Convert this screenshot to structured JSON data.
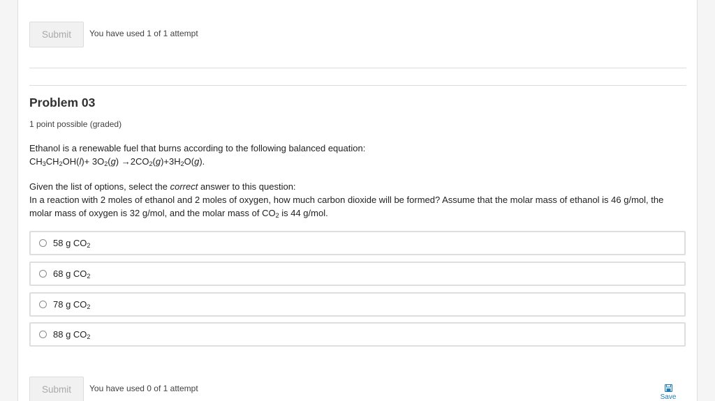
{
  "top_submit": {
    "button_label": "Submit",
    "attempt_text": "You have used 1 of 1 attempt"
  },
  "problem": {
    "title": "Problem 03",
    "points": "1 point possible (graded)",
    "intro": "Ethanol is a renewable fuel that burns according to the following balanced equation:",
    "equation": {
      "t1": "CH",
      "s1": "3",
      "t2": "CH",
      "s2": "2",
      "t3": "OH(",
      "i1": "l",
      "t4": ")+ 3O",
      "s3": "2",
      "t5": "(",
      "i2": "g",
      "t6": ") →2CO",
      "s4": "2",
      "t7": "(",
      "i3": "g",
      "t8": ")+3H",
      "s5": "2",
      "t9": "O(",
      "i4": "g",
      "t10": ")."
    },
    "prompt_pre": "Given the list of options, select the ",
    "prompt_em": "correct",
    "prompt_post": " answer to this question:",
    "question_main": "In a reaction with 2 moles of ethanol and 2 moles of oxygen, how much carbon dioxide will be formed? Assume that the molar mass of ethanol is 46 g/mol, the",
    "question_line2_pre": "molar mass of oxygen is 32 g/mol, and the molar mass of CO",
    "question_line2_sub": "2",
    "question_line2_post": " is 44 g/mol.",
    "options": [
      {
        "text": "58 g CO",
        "sub": "2"
      },
      {
        "text": "68 g CO",
        "sub": "2"
      },
      {
        "text": "78 g CO",
        "sub": "2"
      },
      {
        "text": "88 g CO",
        "sub": "2"
      }
    ]
  },
  "bottom_submit": {
    "button_label": "Submit",
    "attempt_text": "You have used 0 of 1 attempt",
    "save_label": "Save"
  },
  "colors": {
    "accent": "#1f7bb5",
    "panel_bg": "#ffffff",
    "page_bg": "#f5f5f5",
    "border": "#dedede"
  },
  "icons": {
    "save": "save-icon",
    "radio": "radio-icon"
  }
}
